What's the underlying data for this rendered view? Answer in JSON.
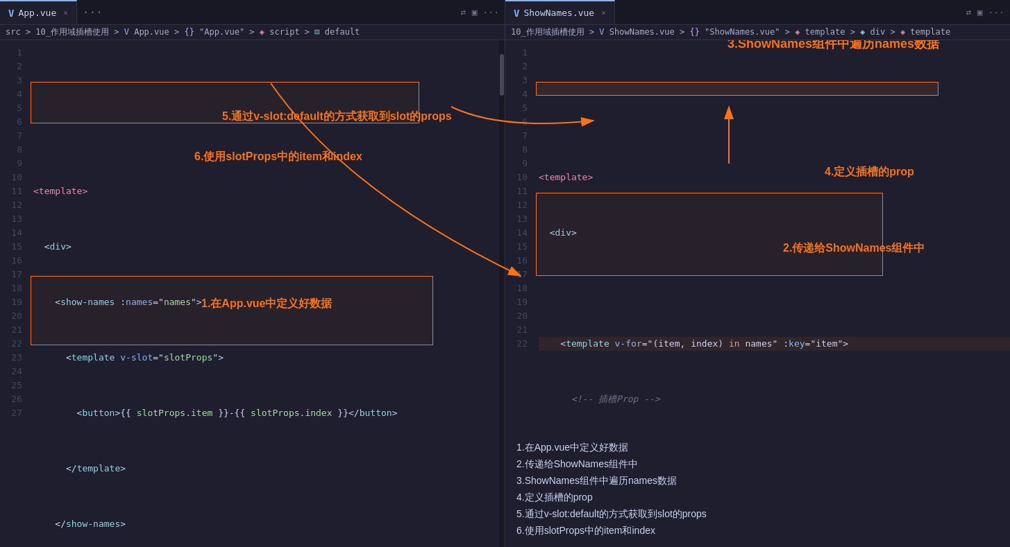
{
  "left_tab": {
    "icon": "V",
    "label": "App.vue",
    "active": true,
    "close": "×"
  },
  "right_tab": {
    "icon": "V",
    "label": "ShowNames.vue",
    "active": true,
    "close": "×"
  },
  "left_breadcrumb": "src > 10_作用域插槽使用 > App.vue > {} \"App.vue\" > script > default",
  "right_breadcrumb": "10_作用域插槽使用 > ShowNames.vue > {} \"ShowNames.vue\" > template > div > template",
  "left_lines": [
    "1",
    "2",
    "3",
    "4",
    "5",
    "6",
    "7",
    "8",
    "9",
    "10",
    "11",
    "12",
    "13",
    "14",
    "15",
    "16",
    "17",
    "18",
    "19",
    "20",
    "21",
    "22",
    "23",
    "24",
    "25",
    "26",
    "27"
  ],
  "right_lines": [
    "1",
    "2",
    "3",
    "4",
    "5",
    "6",
    "7",
    "8",
    "9",
    "10",
    "11",
    "12",
    "13",
    "14",
    "15",
    "16",
    "17",
    "18",
    "19",
    "20",
    "21",
    "22"
  ],
  "annotations": {
    "a1": "1.在App.vue中定义好数据",
    "a2": "2.传递给ShowNames组件中",
    "a3": "3.ShowNames组件中遍历names数据",
    "a4": "4.定义插槽的prop",
    "a5": "5.通过v-slot:default的方式获取到slot的props",
    "a6": "6.使用slotProps中的item和index",
    "bottom_title": "",
    "bottom_items": [
      "1.在App.vue中定义好数据",
      "2.传递给ShowNames组件中",
      "3.ShowNames组件中遍历names数据",
      "4.定义插槽的prop",
      "5.通过v-slot:default的方式获取到slot的props",
      "6.使用slotProps中的item和index"
    ]
  }
}
